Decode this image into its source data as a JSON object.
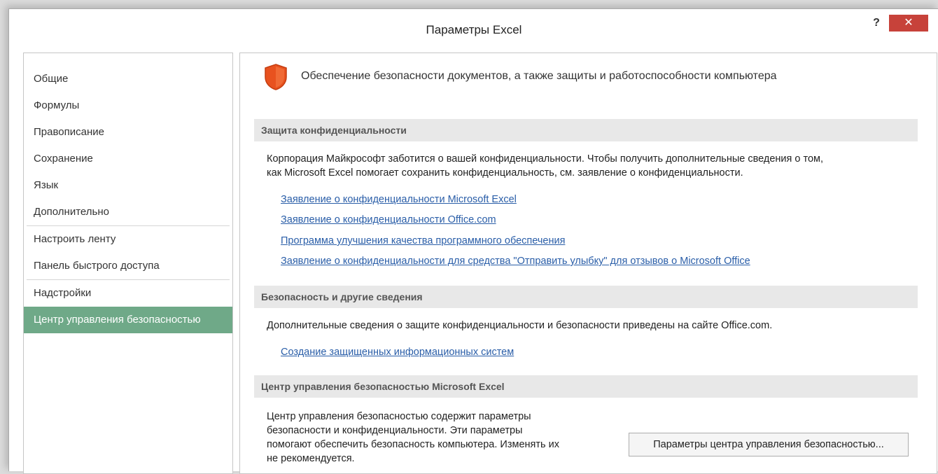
{
  "window": {
    "title": "Параметры Excel",
    "help_label": "?",
    "close_label": "✕"
  },
  "sidebar": {
    "items": [
      {
        "label": "Общие"
      },
      {
        "label": "Формулы"
      },
      {
        "label": "Правописание"
      },
      {
        "label": "Сохранение"
      },
      {
        "label": "Язык"
      },
      {
        "label": "Дополнительно"
      },
      {
        "label": "Настроить ленту"
      },
      {
        "label": "Панель быстрого доступа"
      },
      {
        "label": "Надстройки"
      },
      {
        "label": "Центр управления безопасностью"
      }
    ],
    "selected_index": 9
  },
  "content": {
    "header_text": "Обеспечение безопасности документов, а также защиты и работоспособности компьютера",
    "privacy": {
      "title": "Защита конфиденциальности",
      "line1": "Корпорация Майкрософт заботится о вашей конфиденциальности. Чтобы получить дополнительные сведения о том,",
      "line2": "как Microsoft Excel помогает сохранить конфиденциальность, см. заявление о конфиденциальности.",
      "links": [
        "Заявление о конфиденциальности Microsoft Excel",
        "Заявление о конфиденциальности Office.com",
        "Программа улучшения качества программного обеспечения",
        "Заявление о конфиденциальности для средства \"Отправить улыбку\" для отзывов о Microsoft Office"
      ]
    },
    "security": {
      "title": "Безопасность и другие сведения",
      "text": "Дополнительные сведения о защите конфиденциальности и безопасности приведены на сайте Office.com.",
      "link": "Создание защищенных информационных систем"
    },
    "trust_center": {
      "title": "Центр управления безопасностью Microsoft Excel",
      "line1": "Центр управления безопасностью содержит параметры",
      "line2": "безопасности и конфиденциальности. Эти параметры",
      "line3": "помогают обеспечить безопасность компьютера. Изменять их",
      "line4": "не рекомендуется.",
      "button_label": "Параметры центра управления безопасностью..."
    }
  },
  "colors": {
    "selected_item_bg": "#6fa988",
    "close_button": "#c7423a",
    "link": "#2a5ea8",
    "shield": "#e8521f"
  },
  "icons": {
    "header": "shield-icon"
  }
}
